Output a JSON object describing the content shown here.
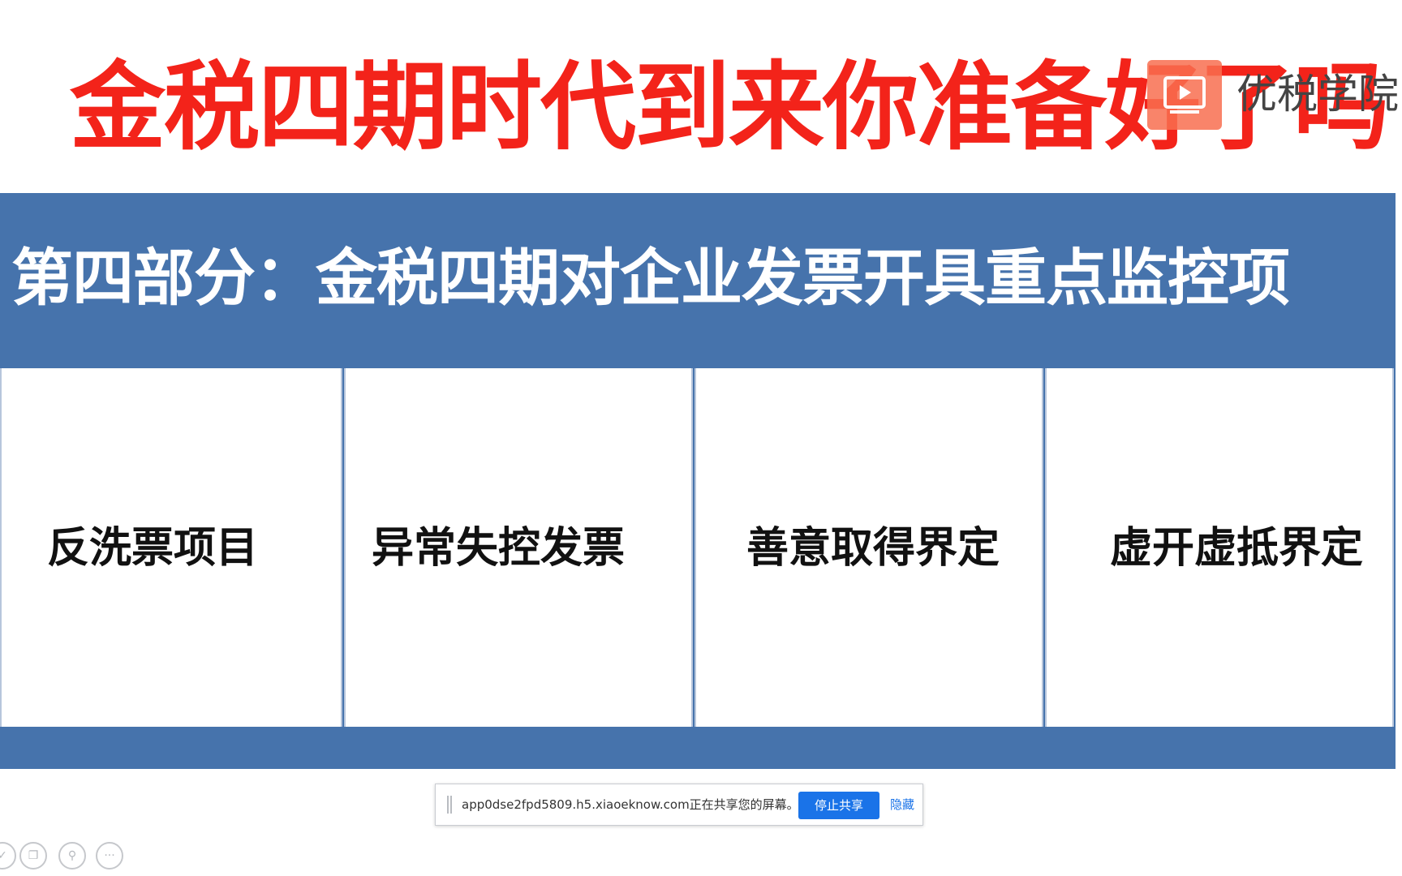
{
  "slide": {
    "title": "金税四期时代到来你准备好了吗",
    "section_title": "第四部分：金税四期对企业发票开具重点监控项",
    "cards": [
      {
        "label": "反洗票项目"
      },
      {
        "label": "异常失控发票"
      },
      {
        "label": "善意取得界定"
      },
      {
        "label": "虚开虚抵界定"
      }
    ]
  },
  "watermark": {
    "logo_icon": "play-icon",
    "text": "优税学院"
  },
  "share_bar": {
    "message": "app0dse2fpd5809.h5.xiaoeknow.com正在共享您的屏幕。",
    "stop_label": "停止共享",
    "hide_label": "隐藏"
  },
  "toolbar": {
    "icons": [
      "check-icon",
      "copy-icon",
      "search-icon",
      "more-icon"
    ]
  },
  "colors": {
    "title_red": "#f3231a",
    "banner_blue": "#4673ac",
    "accent_blue": "#1a73e8"
  }
}
